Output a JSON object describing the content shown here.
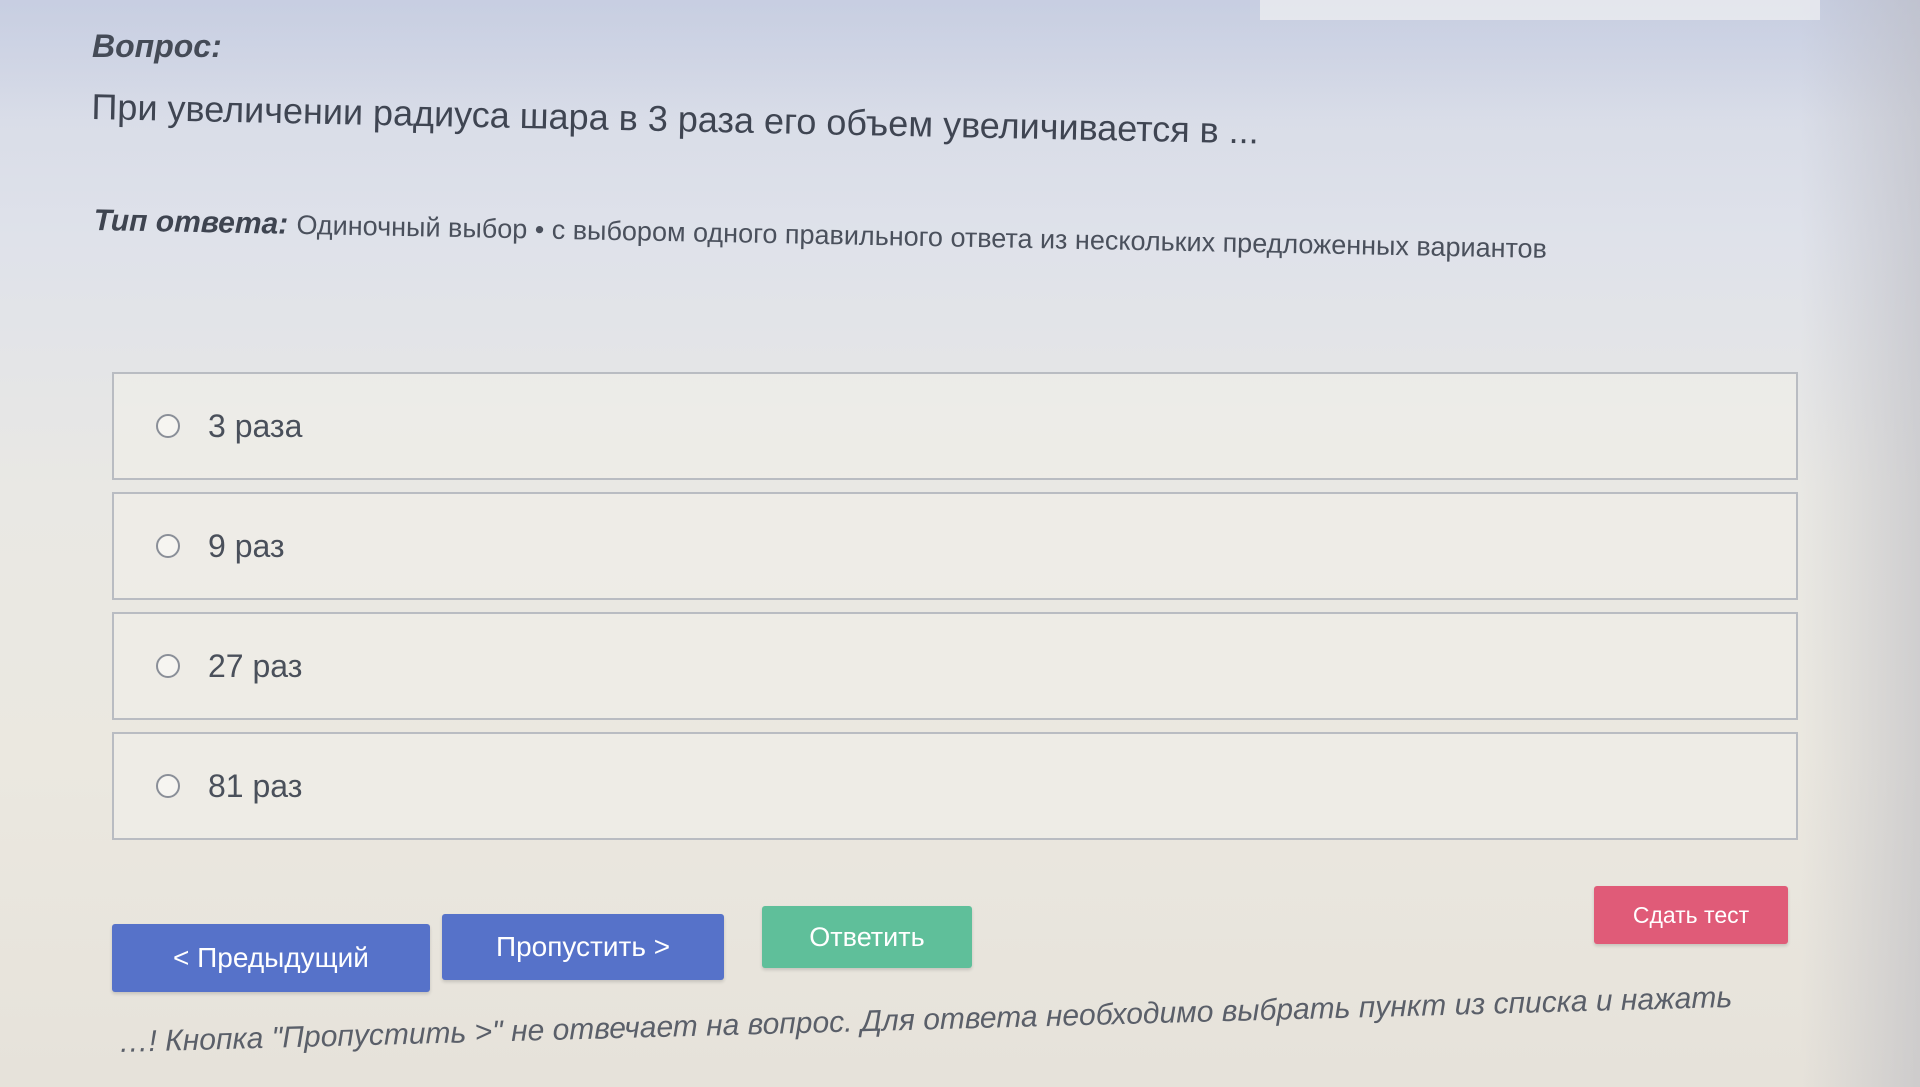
{
  "question": {
    "label": "Вопрос:",
    "text": "При увеличении радиуса шара в 3 раза его объем увеличивается в ..."
  },
  "answer_type": {
    "label": "Тип ответа:",
    "value": "Одиночный выбор • с выбором одного правильного ответа из нескольких предложенных вариантов"
  },
  "options": [
    {
      "label": "3 раза"
    },
    {
      "label": "9 раз"
    },
    {
      "label": "27 раз"
    },
    {
      "label": "81 раз"
    }
  ],
  "buttons": {
    "prev": "< Предыдущий",
    "skip": "Пропустить >",
    "answer": "Ответить",
    "finish": "Сдать тест"
  },
  "footer": {
    "note": "…! Кнопка \"Пропустить >\" не отвечает на вопрос. Для ответа необходимо выбрать пункт из списка и нажать"
  },
  "colors": {
    "primary": "#5672c9",
    "success": "#5fbf9a",
    "danger": "#e05b78"
  }
}
